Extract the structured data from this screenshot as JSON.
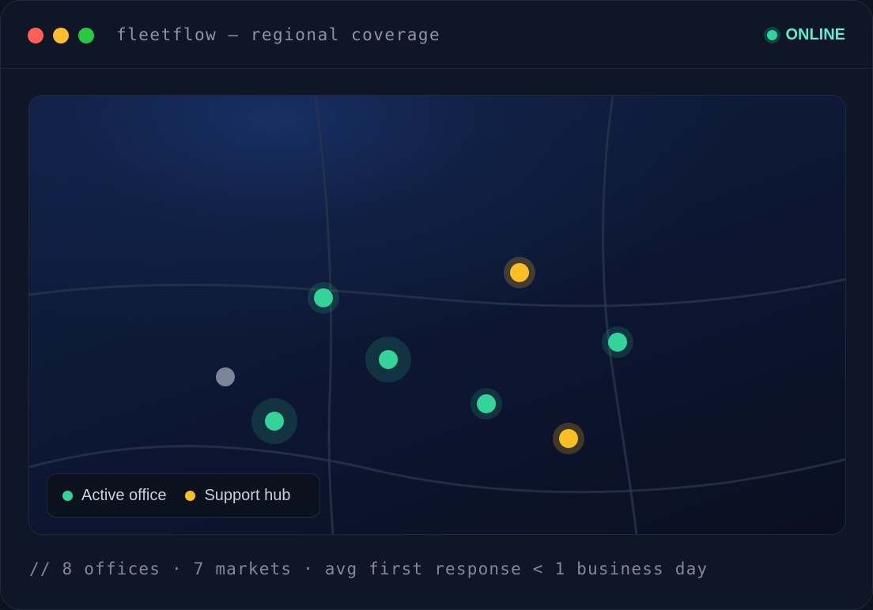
{
  "window": {
    "title": "fleetflow — regional coverage",
    "status": "ONLINE",
    "colors": {
      "background": "#0f1726",
      "status": "#5eead4",
      "active": "#34d399",
      "support": "#fbbf24",
      "inactive": "#7b8498"
    }
  },
  "map": {
    "legend": [
      {
        "label": "Active office",
        "kind": "active"
      },
      {
        "label": "Support hub",
        "kind": "support"
      }
    ],
    "markers": [
      {
        "kind": "active"
      },
      {
        "kind": "support"
      },
      {
        "kind": "active"
      },
      {
        "kind": "active"
      },
      {
        "kind": "inactive"
      },
      {
        "kind": "active"
      },
      {
        "kind": "active"
      },
      {
        "kind": "support"
      }
    ]
  },
  "footer": {
    "text": "// 8 offices · 7 markets · avg first response < 1 business day"
  }
}
